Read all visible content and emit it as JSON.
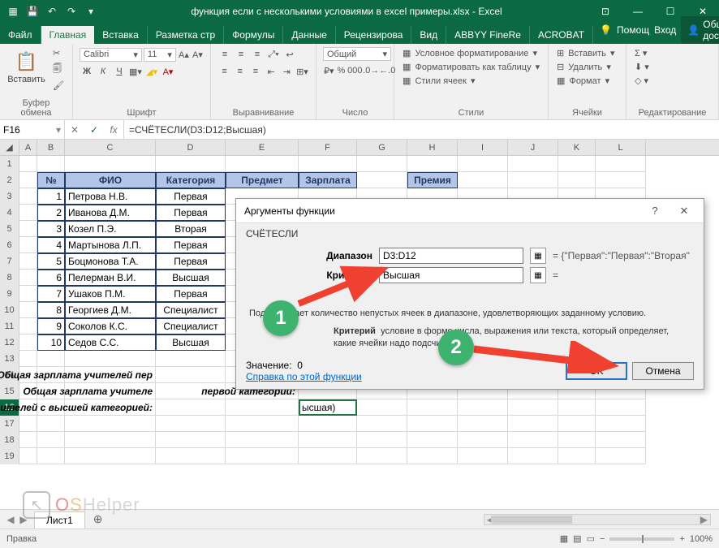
{
  "title": "функция если с несколькими условиями в excel примеры.xlsx - Excel",
  "tabs": {
    "file": "Файл",
    "home": "Главная",
    "insert": "Вставка",
    "layout": "Разметка стр",
    "formulas": "Формулы",
    "data": "Данные",
    "review": "Рецензирова",
    "view": "Вид",
    "abbyy": "ABBYY FineRe",
    "acrobat": "ACROBAT",
    "help": "Помощ",
    "signin": "Вход",
    "share": "Общий доступ"
  },
  "ribbon": {
    "paste": "Вставить",
    "clipboard": "Буфер обмена",
    "font": "Шрифт",
    "font_name": "Calibri",
    "font_size": "11",
    "align": "Выравнивание",
    "number": "Число",
    "number_fmt": "Общий",
    "styles": "Стили",
    "cond": "Условное форматирование",
    "table": "Форматировать как таблицу",
    "cell": "Стили ячеек",
    "cells": "Ячейки",
    "ins": "Вставить",
    "del": "Удалить",
    "fmt": "Формат",
    "edit": "Редактирование"
  },
  "namebox": "F16",
  "formula": "=СЧЁТЕСЛИ(D3:D12;Высшая)",
  "cols": [
    "A",
    "B",
    "C",
    "D",
    "E",
    "F",
    "G",
    "H",
    "I",
    "J",
    "K",
    "L"
  ],
  "table": {
    "headers": {
      "num": "№",
      "fio": "ФИО",
      "cat": "Категория",
      "subj": "Предмет",
      "sal": "Зарплата",
      "bonus": "Премия"
    },
    "rows": [
      {
        "n": "1",
        "fio": "Петрова Н.В.",
        "cat": "Первая"
      },
      {
        "n": "2",
        "fio": "Иванова Д.М.",
        "cat": "Первая"
      },
      {
        "n": "3",
        "fio": "Козел П.Э.",
        "cat": "Вторая"
      },
      {
        "n": "4",
        "fio": "Мартынова Л.П.",
        "cat": "Первая"
      },
      {
        "n": "5",
        "fio": "Боцмонова Т.А.",
        "cat": "Первая"
      },
      {
        "n": "6",
        "fio": "Пелерман В.И.",
        "cat": "Высшая"
      },
      {
        "n": "7",
        "fio": "Ушаков П.М.",
        "cat": "Первая"
      },
      {
        "n": "8",
        "fio": "Георгиев Д.М.",
        "cat": "Специалист"
      },
      {
        "n": "9",
        "fio": "Соколов К.С.",
        "cat": "Специалист"
      },
      {
        "n": "10",
        "fio": "Седов С.С.",
        "cat": "Высшая"
      }
    ]
  },
  "labels": {
    "r14": "Общая зарплата учителей пер",
    "r15a": "Общая зарплата учителе",
    "r15b": "первой категории:",
    "r16": "Количество учителей с высшей категорией:",
    "r16cell": "ысшая)"
  },
  "sheet": "Лист1",
  "statusbar": {
    "mode": "Правка",
    "zoom": "100%"
  },
  "dialog": {
    "title": "Аргументы функции",
    "fn": "СЧЁТЕСЛИ",
    "arg1_label": "Диапазон",
    "arg1_val": "D3:D12",
    "arg1_res": "= {\"Первая\":\"Первая\":\"Вторая\":\"Перва",
    "arg2_label": "Критерий",
    "arg2_val": "Высшая",
    "arg2_res": "=",
    "result_eq": "= 0",
    "desc1": "Подсчитывает количество непустых ячеек в диапазоне, удовлетворяющих заданному условию.",
    "desc2a": "Критерий",
    "desc2b": "условие в форме числа, выражения или текста, который определяет, какие ячейки надо подсчитывать.",
    "value_label": "Значение:",
    "value": "0",
    "help": "Справка по этой функции",
    "ok": "OK",
    "cancel": "Отмена"
  },
  "anno": {
    "b1": "1",
    "b2": "2"
  },
  "watermark": {
    "brand_o": "O",
    "brand_s": "S",
    "rest": "Helper"
  }
}
